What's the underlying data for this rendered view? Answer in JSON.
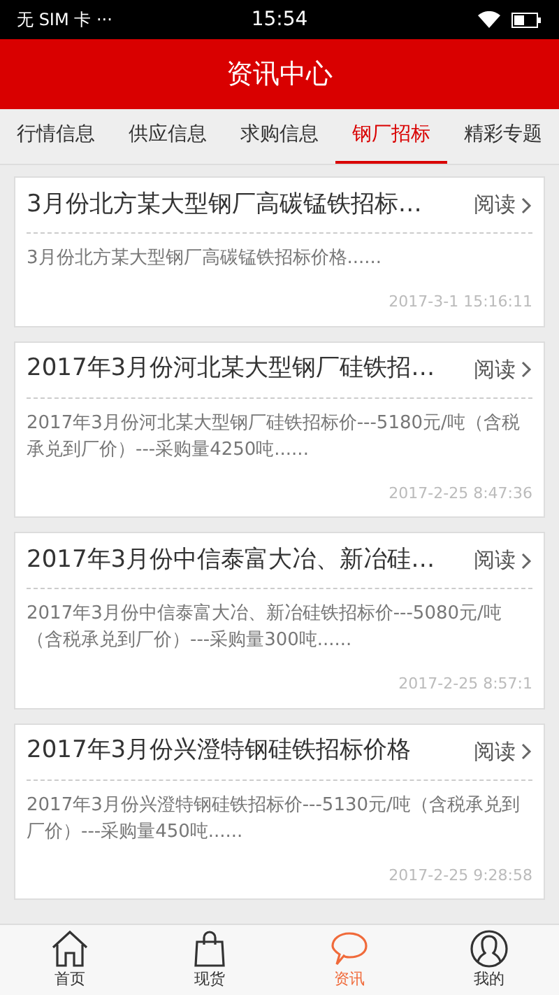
{
  "status_bar": {
    "carrier": "无 SIM 卡 ···",
    "time": "15:54"
  },
  "header": {
    "title": "资讯中心"
  },
  "tabs": [
    {
      "label": "行情信息",
      "selected": false
    },
    {
      "label": "供应信息",
      "selected": false
    },
    {
      "label": "求购信息",
      "selected": false
    },
    {
      "label": "钢厂招标",
      "selected": true
    },
    {
      "label": "精彩专题",
      "selected": false
    }
  ],
  "articles": [
    {
      "title": "3月份北方某大型钢厂高碳锰铁招标…",
      "read": "阅读",
      "summary": "3月份北方某大型钢厂高碳锰铁招标价格......",
      "date": "2017-3-1 15:16:11"
    },
    {
      "title": "2017年3月份河北某大型钢厂硅铁招…",
      "read": "阅读",
      "summary": "2017年3月份河北某大型钢厂硅铁招标价---5180元/吨（含税承兑到厂价）---采购量4250吨......",
      "date": "2017-2-25 8:47:36"
    },
    {
      "title": "2017年3月份中信泰富大冶、新冶硅…",
      "read": "阅读",
      "summary": "2017年3月份中信泰富大冶、新冶硅铁招标价---5080元/吨（含税承兑到厂价）---采购量300吨......",
      "date": "2017-2-25 8:57:1"
    },
    {
      "title": "2017年3月份兴澄特钢硅铁招标价格",
      "read": "阅读",
      "summary": "2017年3月份兴澄特钢硅铁招标价---5130元/吨（含税承兑到厂价）---采购量450吨......",
      "date": "2017-2-25 9:28:58"
    }
  ],
  "bottom_nav": [
    {
      "label": "首页",
      "kind": "home",
      "selected": false
    },
    {
      "label": "现货",
      "kind": "bag",
      "selected": false
    },
    {
      "label": "资讯",
      "kind": "chat",
      "selected": true
    },
    {
      "label": "我的",
      "kind": "person",
      "selected": false
    }
  ]
}
